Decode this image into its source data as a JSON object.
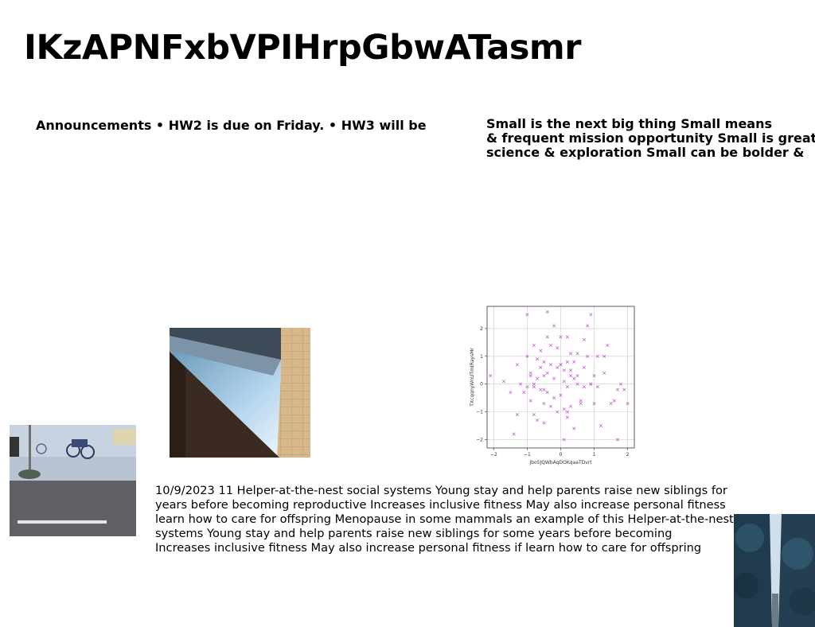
{
  "title": "IKzAPNFxbVPIHrpGbwATasmr",
  "announcements": "Announcements • HW2 is due on Friday. • HW3 will be",
  "small_block": {
    "lines": [
      "Small is the next big thing Small means",
      "& frequent mission opportunity Small is great",
      "science & exploration Small can be bolder &"
    ]
  },
  "body_paragraph": {
    "lines": [
      "10/9/2023 11 Helper-at-the-nest social systems Young stay and help parents raise new siblings for",
      "years before becoming reproductive Increases inclusive fitness May also increase personal fitness",
      "learn how to care for offspring Menopause in some mammals an example of this Helper-at-the-nest",
      "systems Young stay and help parents raise new siblings for some years before becoming",
      "Increases inclusive fitness May also increase personal fitness if learn how to care for offspring"
    ]
  },
  "chart_data": {
    "type": "scatter",
    "xlabel": "Jbo5JQWbAqDOKqaaTDvrt",
    "ylabel": "TXcqqnyWnUTmIRaysMr",
    "xlim": [
      -2.2,
      2.2
    ],
    "ylim": [
      -2.3,
      2.8
    ],
    "xticks": [
      -2,
      -1,
      0,
      1,
      2
    ],
    "yticks": [
      -2,
      -1,
      0,
      1,
      2
    ],
    "grid": true,
    "marker": "x",
    "color": "#c050d0",
    "x": [
      -2.1,
      -1.7,
      -1.5,
      -1.4,
      -1.3,
      -1.2,
      -1.1,
      -1.0,
      -1.0,
      -0.9,
      -0.9,
      -0.9,
      -0.8,
      -0.8,
      -0.8,
      -0.8,
      -0.7,
      -0.7,
      -0.7,
      -0.6,
      -0.6,
      -0.6,
      -0.5,
      -0.5,
      -0.5,
      -0.5,
      -0.4,
      -0.4,
      -0.4,
      -0.4,
      -0.3,
      -0.3,
      -0.3,
      -0.2,
      -0.2,
      -0.2,
      -0.1,
      -0.1,
      -0.1,
      0.0,
      0.0,
      0.0,
      0.1,
      0.1,
      0.1,
      0.1,
      0.2,
      0.2,
      0.2,
      0.2,
      0.3,
      0.3,
      0.3,
      0.3,
      0.4,
      0.4,
      0.4,
      0.5,
      0.5,
      0.5,
      0.6,
      0.6,
      0.7,
      0.7,
      0.7,
      0.8,
      0.8,
      0.9,
      0.9,
      1.0,
      1.0,
      1.1,
      1.1,
      1.2,
      1.3,
      1.3,
      1.4,
      1.5,
      1.6,
      1.7,
      1.7,
      1.8,
      1.9,
      2.0,
      -0.5,
      0.0,
      0.2,
      -1.3,
      0.9,
      -1.0
    ],
    "y": [
      0.3,
      0.1,
      -0.3,
      -1.8,
      0.7,
      0.0,
      -0.3,
      1.0,
      2.5,
      0.4,
      -0.6,
      0.3,
      1.4,
      -1.1,
      -0.1,
      0.0,
      0.9,
      0.2,
      -1.3,
      1.2,
      0.6,
      -0.2,
      0.8,
      0.3,
      -0.7,
      -1.4,
      1.7,
      2.6,
      0.4,
      -0.3,
      1.4,
      0.7,
      -0.8,
      2.1,
      0.2,
      -0.5,
      1.3,
      0.6,
      -1.0,
      1.7,
      0.7,
      -0.4,
      -2.0,
      0.5,
      0.1,
      -0.9,
      1.7,
      0.8,
      -0.1,
      -1.2,
      1.1,
      0.3,
      -0.8,
      0.5,
      0.8,
      0.2,
      -1.6,
      1.1,
      0.0,
      0.3,
      -0.6,
      -0.7,
      1.6,
      0.6,
      -0.1,
      2.1,
      1.0,
      2.5,
      0.0,
      -0.7,
      0.3,
      1.0,
      -0.1,
      -1.5,
      1.0,
      0.4,
      1.4,
      -0.7,
      -0.6,
      -2.0,
      -0.2,
      0.0,
      -0.2,
      -0.7,
      -0.2,
      0.7,
      -1.0,
      -1.1,
      0.0,
      -0.1
    ]
  },
  "images": {
    "building_alt": "photo-building",
    "street_alt": "photo-street",
    "trees_alt": "photo-trees"
  }
}
